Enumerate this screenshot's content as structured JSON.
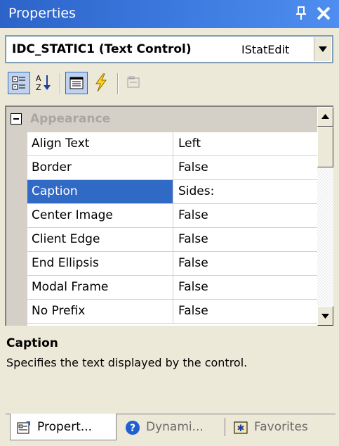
{
  "window": {
    "title": "Properties",
    "pin_glyph": "⨄",
    "close_glyph": "✕"
  },
  "object_selector": {
    "object_name": "IDC_STATIC1 (Text Control)",
    "class_name": "IStatEdit"
  },
  "toolbar": {
    "buttons": [
      "categorized-icon",
      "alphabetical-icon",
      "properties-icon",
      "events-icon",
      "property-pages-icon"
    ]
  },
  "category": {
    "label": "Appearance",
    "expanded": true
  },
  "properties": [
    {
      "name": "Align Text",
      "value": "Left"
    },
    {
      "name": "Border",
      "value": "False"
    },
    {
      "name": "Caption",
      "value": "Sides:"
    },
    {
      "name": "Center Image",
      "value": "False"
    },
    {
      "name": "Client Edge",
      "value": "False"
    },
    {
      "name": "End Ellipsis",
      "value": "False"
    },
    {
      "name": "Modal Frame",
      "value": "False"
    },
    {
      "name": "No Prefix",
      "value": "False"
    }
  ],
  "selected_property": "Caption",
  "description": {
    "title": "Caption",
    "text": "Specifies the text displayed by the control."
  },
  "tabs": [
    {
      "label": "Propert...",
      "active": true
    },
    {
      "label": "Dynami...",
      "active": false
    },
    {
      "label": "Favorites",
      "active": false
    }
  ],
  "colors": {
    "titlebar": "#3d7be0",
    "selection": "#316ac5",
    "panel": "#ece9d8"
  }
}
